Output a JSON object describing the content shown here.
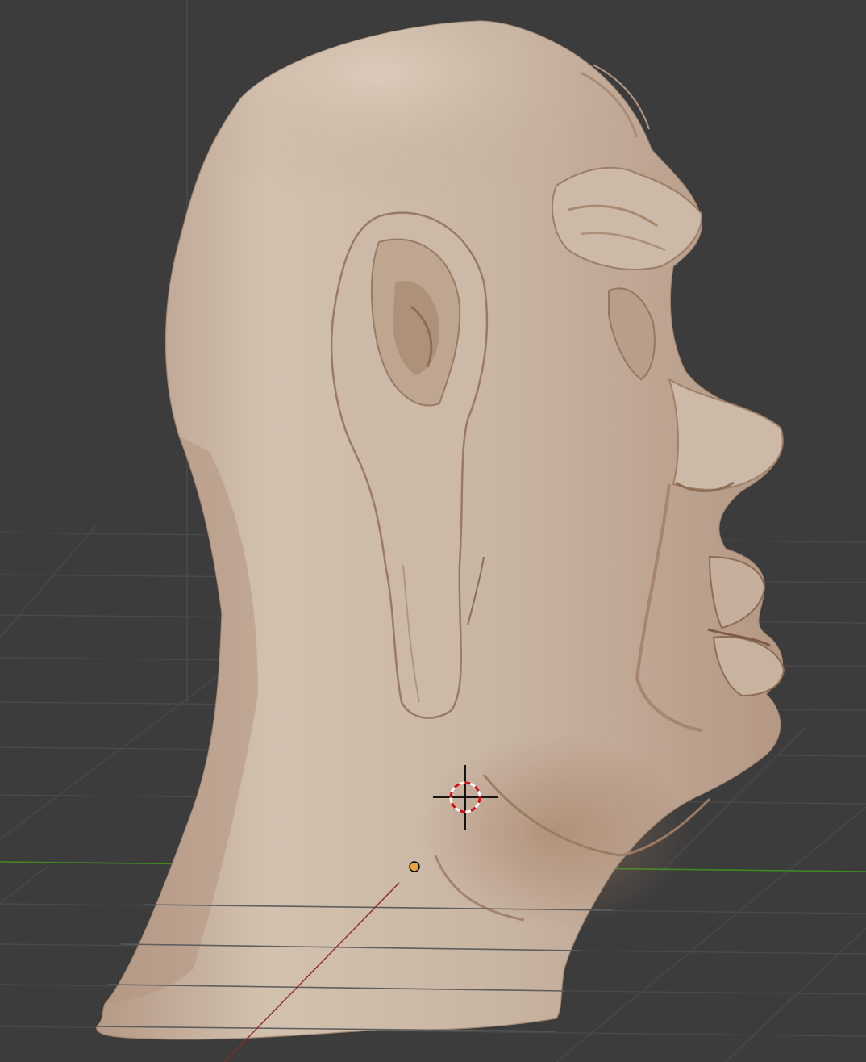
{
  "viewport": {
    "view": "3D Viewport",
    "mode": "sculpt",
    "subject": "head-sculpt",
    "colors": {
      "background": "#3c3c3c",
      "grid_line": "#484848",
      "grid_line_strong": "#555555",
      "x_axis": "#8a2a2a",
      "y_axis": "#3d8a1e",
      "sculpt_clay": "#c9b6a4",
      "sculpt_shadow": "#9e7c64",
      "origin_point": "#e8a43c"
    },
    "icons": {
      "cursor": "3d-cursor-icon",
      "origin": "object-origin-icon"
    }
  }
}
